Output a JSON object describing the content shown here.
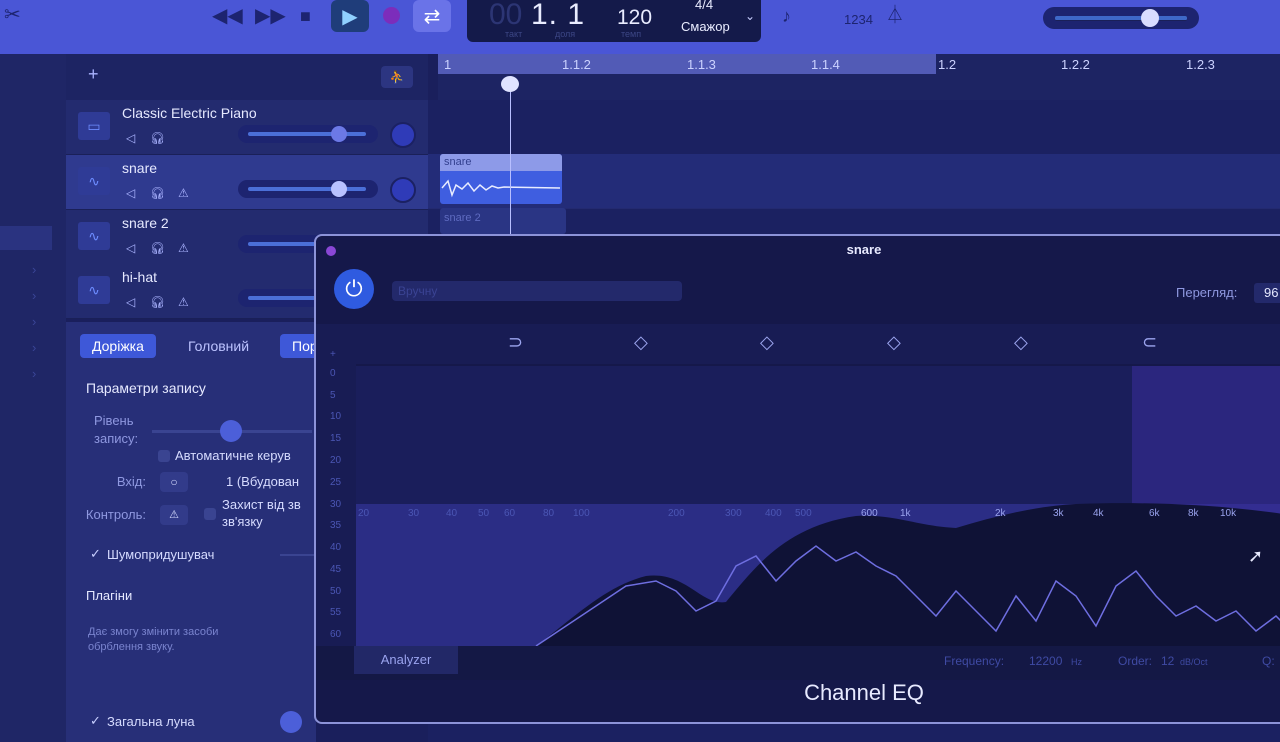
{
  "toolbar": {
    "lcd": {
      "position_ghost": "00",
      "position": "1. 1",
      "position_sub_bar": "такт",
      "position_sub_beat": "доля",
      "tempo": "120",
      "tempo_sub": "темп",
      "time_signature": "4/4",
      "key": "Смажор"
    },
    "lcd_display_label": "1234",
    "icons": [
      "scissors-icon",
      "rewind-icon",
      "fast-forward-icon",
      "stop-icon",
      "play-icon",
      "record-icon",
      "cycle-icon",
      "tuner-icon",
      "count-in-icon",
      "metronome-icon"
    ]
  },
  "tracks_header": {
    "add_symbol": "+"
  },
  "tracks": [
    {
      "name": "Classic Electric Piano",
      "icon": "piano-icon"
    },
    {
      "name": "snare",
      "icon": "waveform-icon",
      "selected": true
    },
    {
      "name": "snare 2",
      "icon": "waveform-icon"
    },
    {
      "name": "hi-hat",
      "icon": "waveform-icon"
    }
  ],
  "ruler": {
    "labels": [
      "1",
      "1.1.2",
      "1.1.3",
      "1.1.4",
      "1.2",
      "1.2.2",
      "1.2.3"
    ]
  },
  "regions": {
    "snare": "snare",
    "snare2": "snare 2"
  },
  "inspector": {
    "tabs": [
      "Доріжка",
      "Головний",
      "Пор"
    ],
    "record_settings_title": "Параметри запису",
    "record_level_label": "Рівень\nзапису:",
    "auto_control": "Автоматичне керув",
    "input_label": "Вхід:",
    "input_value": "1 (Вбудован",
    "monitor_label": "Контроль:",
    "feedback_protection": "Захист від зв\nзв'язку",
    "noise_gate": "Шумопридушувач",
    "plugins_title": "Плагіни",
    "plugins_hint": "Дає змогу змінити засоби\nобрблення звуку.",
    "master_echo": "Загальна луна"
  },
  "eq": {
    "title": "snare",
    "preset_placeholder": "Вручну",
    "view_label": "Перегляд:",
    "view_value": "96",
    "db_labels": [
      "+",
      "0",
      "5",
      "10",
      "15",
      "20",
      "25",
      "30",
      "35",
      "40",
      "45",
      "50",
      "55",
      "60"
    ],
    "freq_labels": [
      "20",
      "30",
      "40",
      "50",
      "60",
      "80",
      "100",
      "200",
      "300",
      "400",
      "500",
      "600",
      "1k",
      "2k",
      "3k",
      "4k",
      "6k",
      "8k",
      "10k"
    ],
    "analyzer": "Analyzer",
    "frequency_label": "Frequency:",
    "frequency_value": "12200",
    "frequency_unit": "Hz",
    "order_label": "Order:",
    "order_value": "12",
    "order_unit": "dB/Oct",
    "q_label": "Q:",
    "footer": "Channel EQ"
  }
}
